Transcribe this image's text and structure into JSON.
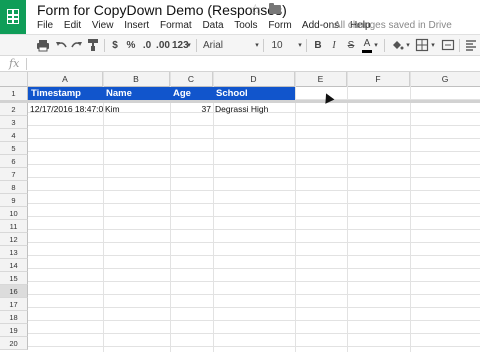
{
  "app": {
    "title": "Form for CopyDown Demo (Responses)",
    "star_glyph": "☆",
    "save_status": "All changes saved in Drive"
  },
  "menu": [
    "File",
    "Edit",
    "View",
    "Insert",
    "Format",
    "Data",
    "Tools",
    "Form",
    "Add-ons",
    "Help"
  ],
  "toolbar": {
    "print_icon": "print-icon",
    "undo_icon": "undo-icon",
    "redo_icon": "redo-icon",
    "paint_format_icon": "paint-format-icon",
    "currency": "$",
    "percent": "%",
    "decrease_decimal": ".0",
    "increase_decimal": ".00",
    "more_formats": "123",
    "font": "Arial",
    "font_size": "10",
    "bold": "B",
    "italic": "I",
    "strikethrough": "S",
    "text_color": "A",
    "text_color_value": "#000000"
  },
  "formula_bar": {
    "fx": "fx",
    "value": ""
  },
  "columns": [
    "A",
    "B",
    "C",
    "D",
    "E",
    "F",
    "G"
  ],
  "rows": [
    "1",
    "2",
    "3",
    "4",
    "5",
    "6",
    "7",
    "8",
    "9",
    "10",
    "11",
    "12",
    "13",
    "14",
    "15",
    "16",
    "17",
    "18",
    "19",
    "20"
  ],
  "selected_row": "16",
  "header_row": {
    "A": "Timestamp",
    "B": "Name",
    "C": "Age",
    "D": "School",
    "fill_color": "#1155cc",
    "text_color": "#ffffff"
  },
  "data_rows": [
    {
      "A": "12/17/2016 18:47:0",
      "B": "Kim",
      "C": "37",
      "D": "Degrassi High"
    }
  ]
}
